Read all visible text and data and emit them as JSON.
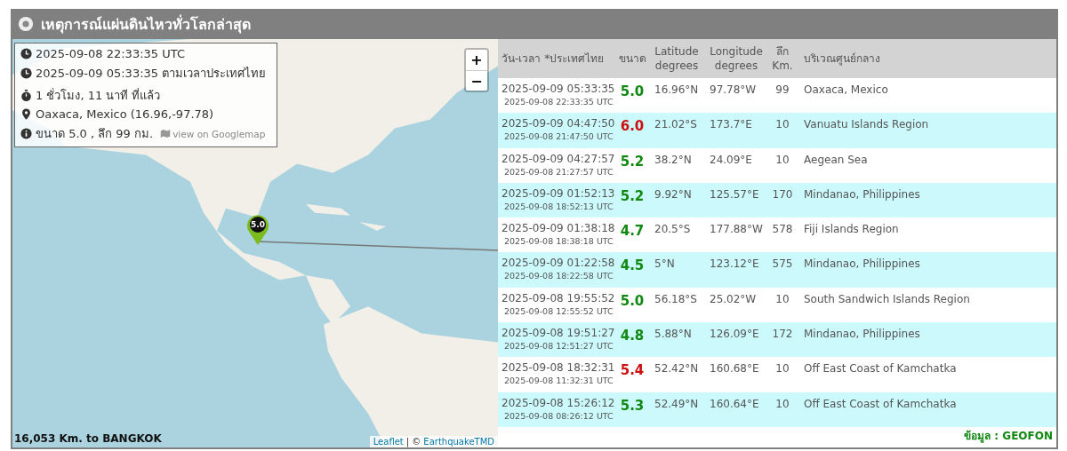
{
  "panel": {
    "title": "เหตุการณ์แผ่นดินไหวทั่วโลกล่าสุด"
  },
  "map": {
    "zoom_in": "+",
    "zoom_out": "−",
    "marker": "5.0",
    "distance": "16,053 Km. to BANGKOK",
    "attribution_leaflet": "Leaflet",
    "attribution_sep": "| ©",
    "attribution_source": "EarthquakeTMD",
    "info": {
      "utc": "2025-09-08 22:33:35 UTC",
      "local": "2025-09-09 05:33:35 ตามเวลาประเทศไทย",
      "ago": "1 ชั่วโมง, 11 นาที ที่แล้ว",
      "place": "Oaxaca, Mexico (16.96,-97.78)",
      "summary": "ขนาด 5.0 , ลึก 99 กม.",
      "map_link": "view on Googlemap"
    }
  },
  "table": {
    "columns": [
      "วัน-เวลา *ประเทศไทย",
      "ขนาด",
      "Latitude degrees",
      "Longitude degrees",
      "ลึก Km.",
      "บริเวณศูนย์กลาง"
    ],
    "rows": [
      {
        "local": "2025-09-09 05:33:35",
        "utc": "2025-09-08 22:33:35 UTC",
        "mag": "5.0",
        "color": "#118811",
        "lat": "16.96°N",
        "lon": "97.78°W",
        "depth": "99",
        "region": "Oaxaca, Mexico"
      },
      {
        "local": "2025-09-09 04:47:50",
        "utc": "2025-09-08 21:47:50 UTC",
        "mag": "6.0",
        "color": "#cc1111",
        "lat": "21.02°S",
        "lon": "173.7°E",
        "depth": "10",
        "region": "Vanuatu Islands Region"
      },
      {
        "local": "2025-09-09 04:27:57",
        "utc": "2025-09-08 21:27:57 UTC",
        "mag": "5.2",
        "color": "#118811",
        "lat": "38.2°N",
        "lon": "24.09°E",
        "depth": "10",
        "region": "Aegean Sea"
      },
      {
        "local": "2025-09-09 01:52:13",
        "utc": "2025-09-08 18:52:13 UTC",
        "mag": "5.2",
        "color": "#118811",
        "lat": "9.92°N",
        "lon": "125.57°E",
        "depth": "170",
        "region": "Mindanao, Philippines"
      },
      {
        "local": "2025-09-09 01:38:18",
        "utc": "2025-09-08 18:38:18 UTC",
        "mag": "4.7",
        "color": "#118811",
        "lat": "20.5°S",
        "lon": "177.88°W",
        "depth": "578",
        "region": "Fiji Islands Region"
      },
      {
        "local": "2025-09-09 01:22:58",
        "utc": "2025-09-08 18:22:58 UTC",
        "mag": "4.5",
        "color": "#118811",
        "lat": "5°N",
        "lon": "123.12°E",
        "depth": "575",
        "region": "Mindanao, Philippines"
      },
      {
        "local": "2025-09-08 19:55:52",
        "utc": "2025-09-08 12:55:52 UTC",
        "mag": "5.0",
        "color": "#118811",
        "lat": "56.18°S",
        "lon": "25.02°W",
        "depth": "10",
        "region": "South Sandwich Islands Region"
      },
      {
        "local": "2025-09-08 19:51:27",
        "utc": "2025-09-08 12:51:27 UTC",
        "mag": "4.8",
        "color": "#118811",
        "lat": "5.88°N",
        "lon": "126.09°E",
        "depth": "172",
        "region": "Mindanao, Philippines"
      },
      {
        "local": "2025-09-08 18:32:31",
        "utc": "2025-09-08 11:32:31 UTC",
        "mag": "5.4",
        "color": "#cc1111",
        "lat": "52.42°N",
        "lon": "160.68°E",
        "depth": "10",
        "region": "Off East Coast of Kamchatka"
      },
      {
        "local": "2025-09-08 15:26:12",
        "utc": "2025-09-08 08:26:12 UTC",
        "mag": "5.3",
        "color": "#118811",
        "lat": "52.49°N",
        "lon": "160.64°E",
        "depth": "10",
        "region": "Off East Coast of Kamchatka"
      }
    ],
    "source": "ข้อมูล : GEOFON"
  }
}
